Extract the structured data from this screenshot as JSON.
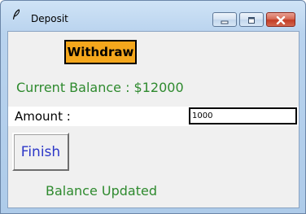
{
  "window": {
    "title": "Deposit",
    "icon": "feather-icon",
    "controls": {
      "minimize": "minimize-icon",
      "maximize": "maximize-icon",
      "close": "close-icon"
    }
  },
  "form": {
    "header_label": "Withdraw",
    "balance_text": "Current Balance : $12000",
    "amount_label": "Amount :",
    "amount_value": "1000",
    "finish_label": "Finish",
    "status_text": "Balance Updated"
  },
  "colors": {
    "header_bg": "#f4a71c",
    "balance_text": "#2e8a2e",
    "finish_text": "#2c37c8",
    "status_text": "#2e8a2e",
    "close_button": "#c33c25"
  }
}
